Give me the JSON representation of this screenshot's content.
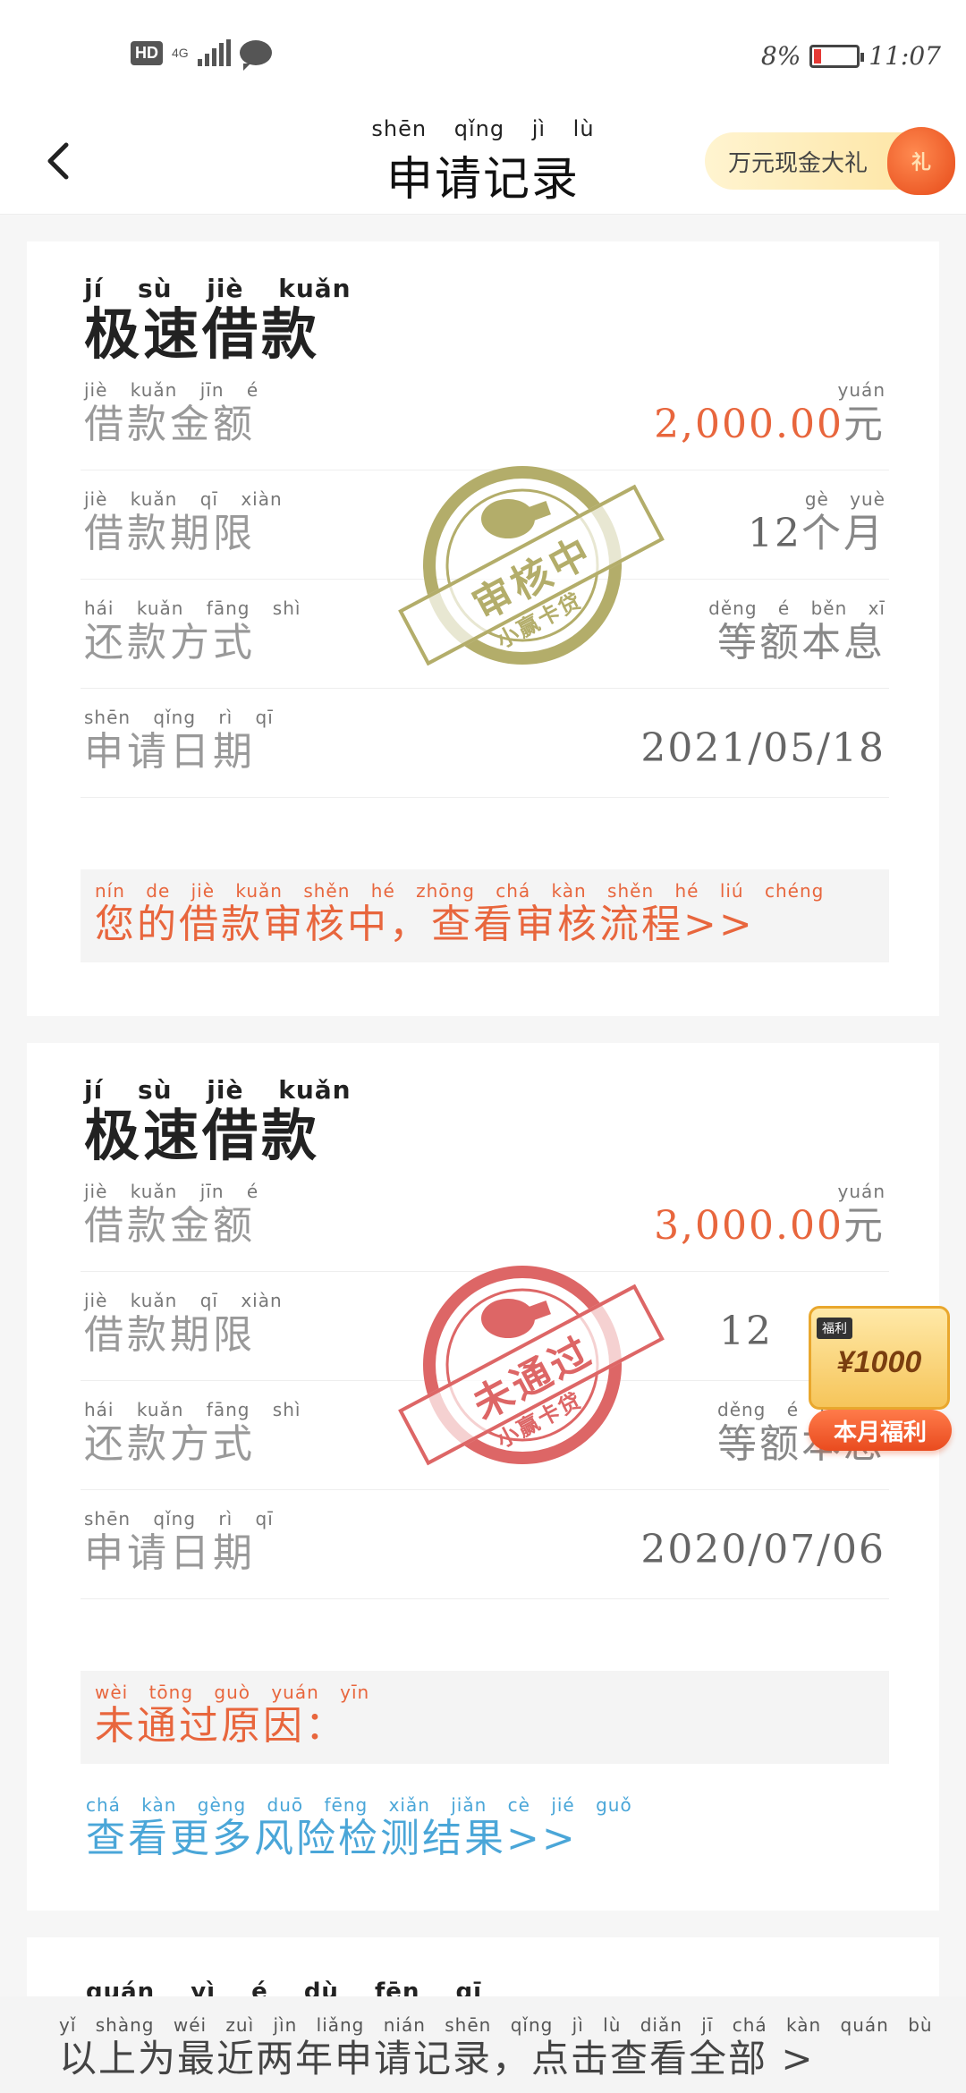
{
  "status_bar": {
    "hd": "HD",
    "network": "4G",
    "battery_percent": "8%",
    "time": "11:07"
  },
  "header": {
    "title_pinyin": "shēn qǐng jì lù",
    "title": "申请记录",
    "promo_text": "万元现金大礼",
    "promo_badge": "礼"
  },
  "cards": [
    {
      "title_pinyin": "jí sù jiè kuǎn",
      "title": "极速借款",
      "rows": [
        {
          "label_pinyin": "jiè kuǎn jīn é",
          "label": "借款金额",
          "value": "2,000.00",
          "unit_pinyin": "yuán",
          "unit": "元"
        },
        {
          "label_pinyin": "jiè kuǎn qī xiàn",
          "label": "借款期限",
          "value": "12",
          "unit_pinyin": "gè yuè",
          "unit": "个月"
        },
        {
          "label_pinyin": "hái kuǎn fāng shì",
          "label": "还款方式",
          "value_pinyin": "děng é běn xī",
          "value_text": "等额本息"
        },
        {
          "label_pinyin": "shēn qǐng rì qī",
          "label": "申请日期",
          "value": "2021/05/18"
        }
      ],
      "notice_pinyin": "nín de jiè kuǎn shěn hé zhōng chá kàn shěn hé liú chéng",
      "notice": "您的借款审核中，查看审核流程>>",
      "stamp": {
        "text": "审核中",
        "sub": "小赢卡贷",
        "color": "#b3ad6a"
      }
    },
    {
      "title_pinyin": "jí sù jiè kuǎn",
      "title": "极速借款",
      "rows": [
        {
          "label_pinyin": "jiè kuǎn jīn é",
          "label": "借款金额",
          "value": "3,000.00",
          "unit_pinyin": "yuán",
          "unit": "元"
        },
        {
          "label_pinyin": "jiè kuǎn qī xiàn",
          "label": "借款期限",
          "value": "12"
        },
        {
          "label_pinyin": "hái kuǎn fāng shì",
          "label": "还款方式",
          "value_pinyin": "děng é běn",
          "value_text": "等额本息"
        },
        {
          "label_pinyin": "shēn qǐng rì qī",
          "label": "申请日期",
          "value": "2020/07/06"
        }
      ],
      "notice_pinyin": "wèi tōng guò yuán yīn",
      "notice": "未通过原因：",
      "link_pinyin": "chá kàn gèng duō fēng xiǎn jiǎn cè jié guǒ",
      "link": "查看更多风险检测结果>>",
      "stamp": {
        "text": "未通过",
        "sub": "小赢卡贷",
        "color": "#dd6666"
      }
    }
  ],
  "peek_pinyin": "quán yì é dù fēn qī",
  "float_welfare": {
    "tag": "福利",
    "amount": "¥1000",
    "button": "本月福利"
  },
  "bottom_bar": {
    "pinyin": "yǐ shàng wéi zuì jìn liǎng nián shēn qǐng jì lù diǎn jī chá kàn quán bù",
    "text": "以上为最近两年申请记录，点击查看全部 >"
  }
}
